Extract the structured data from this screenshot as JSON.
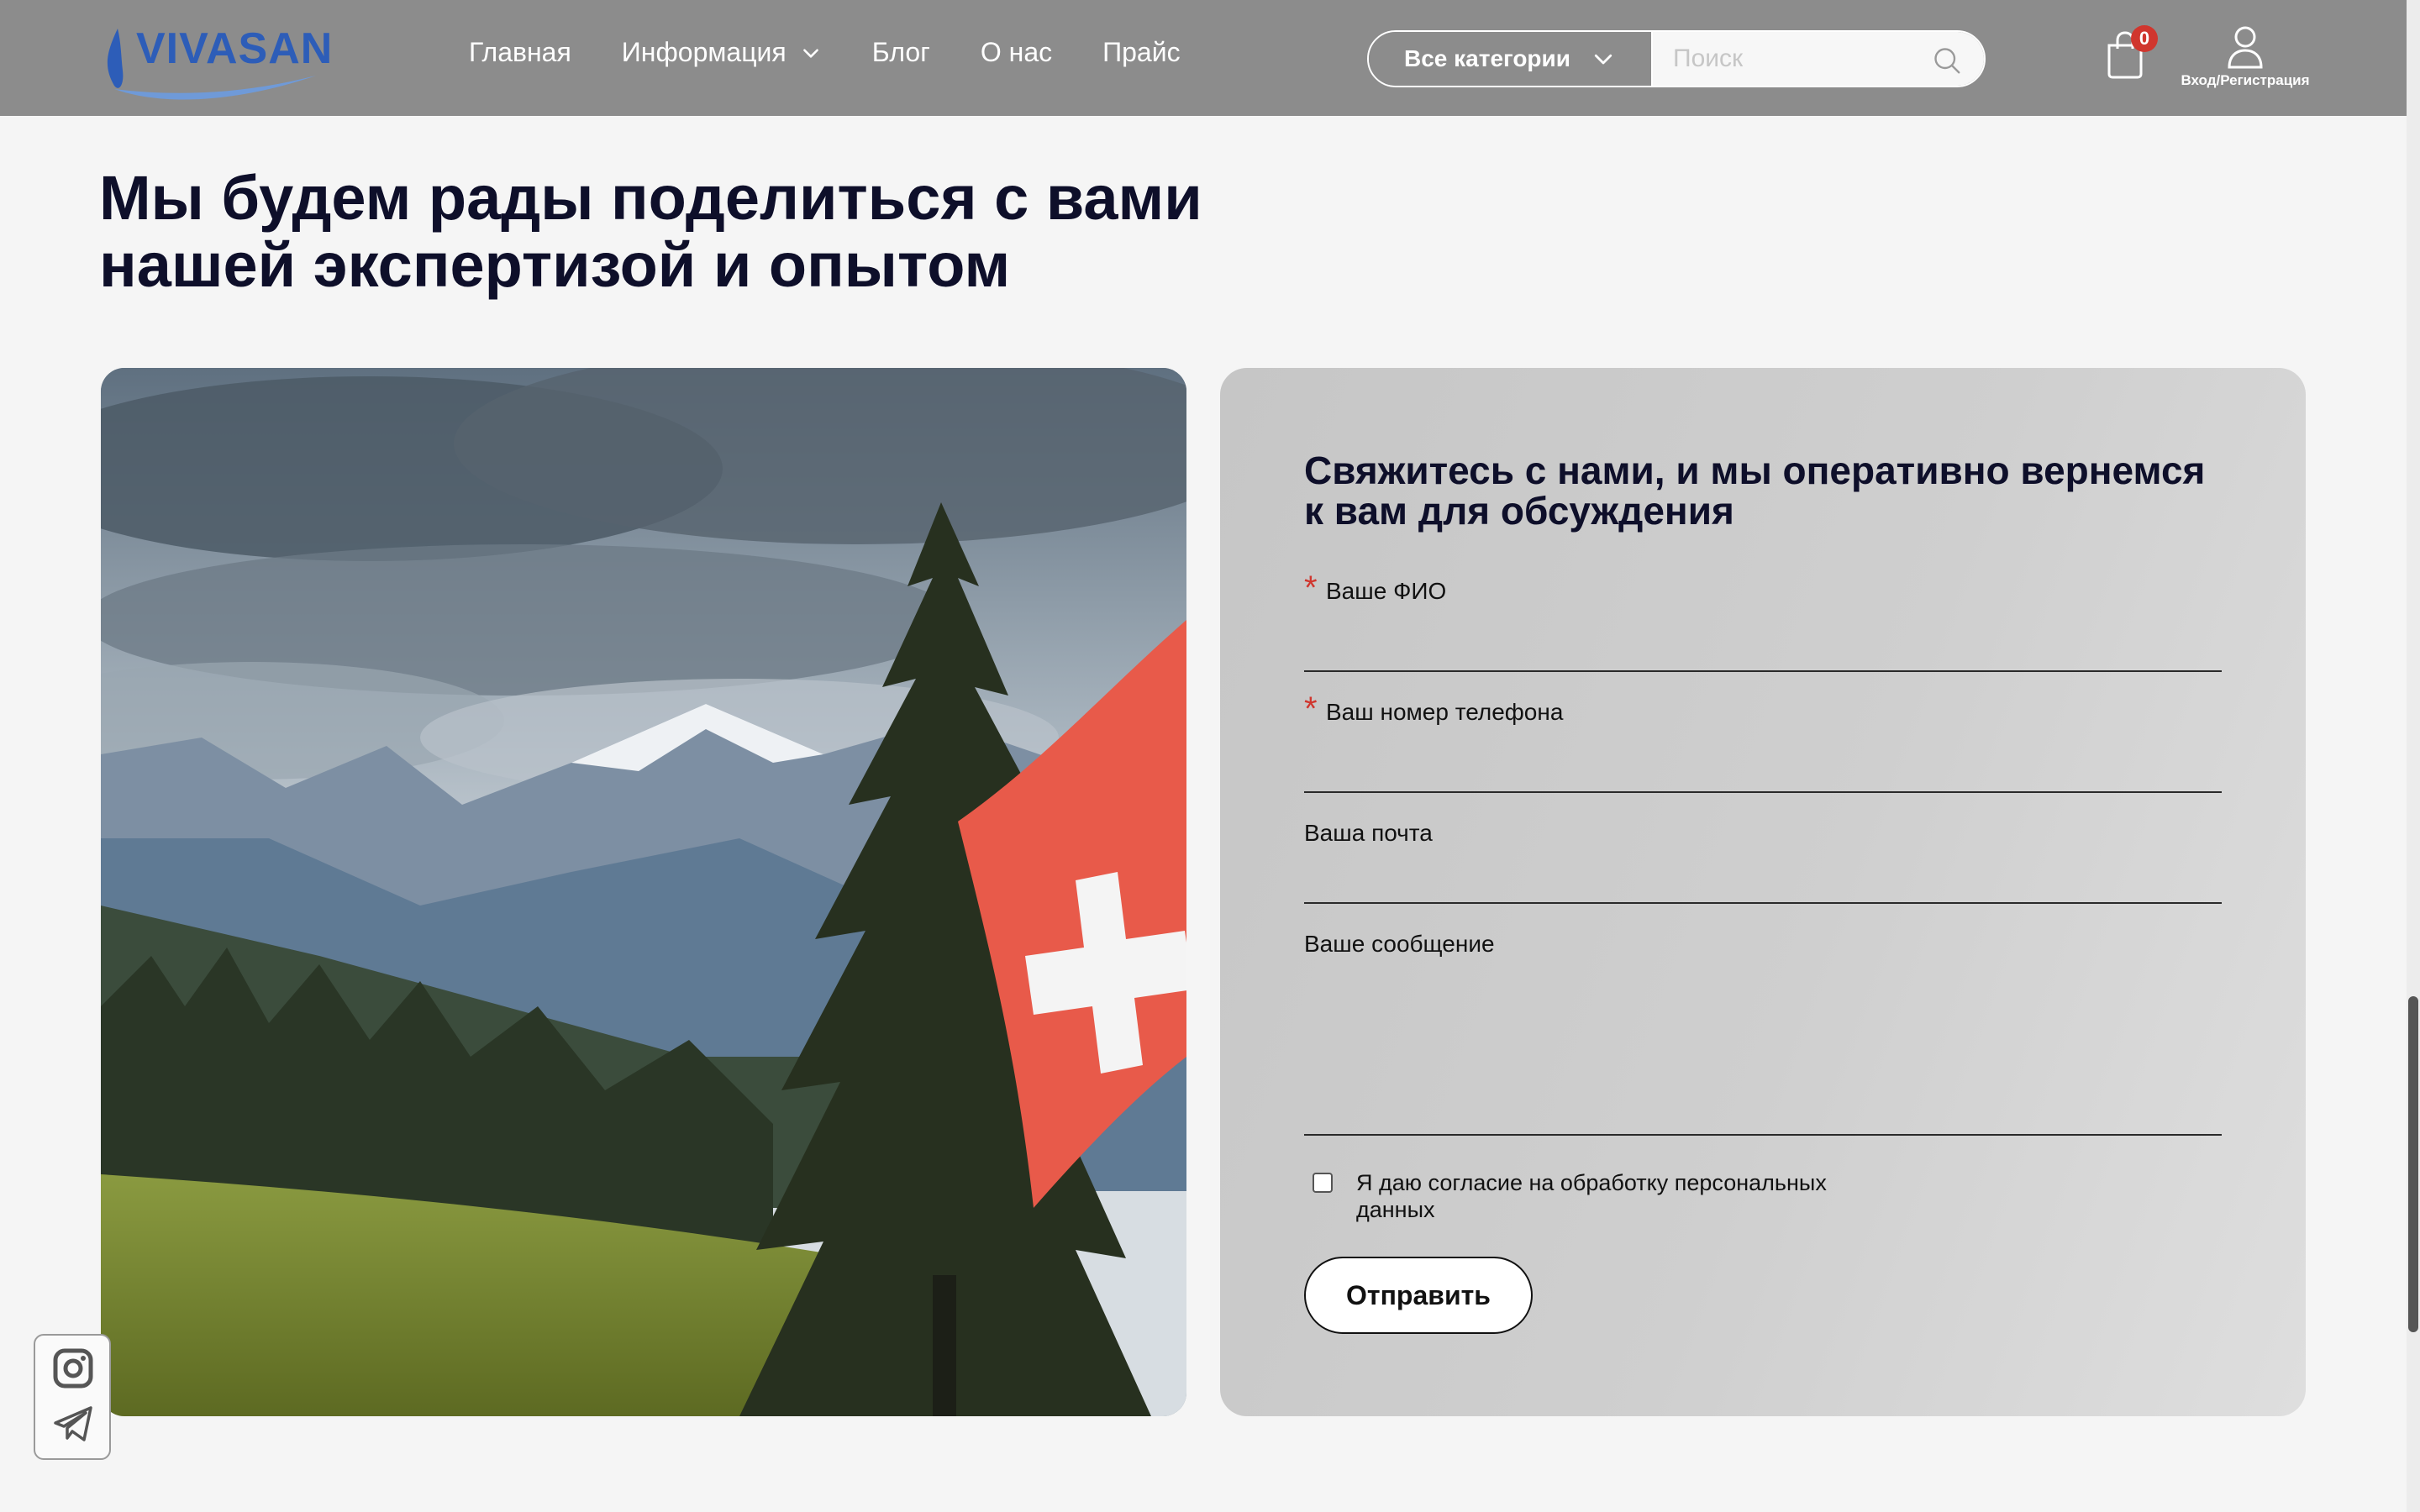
{
  "header": {
    "logo_text": "VIVASAN",
    "nav": [
      {
        "label": "Главная"
      },
      {
        "label": "Информация",
        "has_dropdown": true
      },
      {
        "label": "Блог"
      },
      {
        "label": "О нас"
      },
      {
        "label": "Прайс"
      }
    ],
    "category_select": "Все категории",
    "search_placeholder": "Поиск",
    "cart_count": "0",
    "account_label": "Вход/Регистрация"
  },
  "page": {
    "title_line1": "Мы будем рады поделиться с вами",
    "title_line2": "нашей экспертизой и опытом"
  },
  "form": {
    "title_line1": "Свяжитесь с нами, и мы оперативно вернемся",
    "title_line2": "к вам для обсуждения",
    "required_mark": "*",
    "fields": [
      {
        "label": "Ваше ФИО",
        "required": true,
        "value": ""
      },
      {
        "label": "Ваш номер телефона",
        "required": true,
        "value": ""
      },
      {
        "label": "Ваша почта",
        "required": false,
        "value": ""
      },
      {
        "label": "Ваше сообщение",
        "required": false,
        "value": ""
      }
    ],
    "consent_line1": "Я даю согласие на обработку персональных",
    "consent_line2": "данных",
    "consent_checked": false,
    "submit_label": "Отправить"
  },
  "colors": {
    "header_bg": "#8c8c8c",
    "title": "#0e0f2a",
    "required": "#d0362e",
    "badge": "#d0362e",
    "logo": "#2d5db8"
  },
  "icons": {
    "nav_dropdown": "chevron-down-icon",
    "search": "search-icon",
    "cart": "shopping-bag-icon",
    "account": "user-icon",
    "social": [
      "instagram-icon",
      "telegram-icon"
    ]
  }
}
